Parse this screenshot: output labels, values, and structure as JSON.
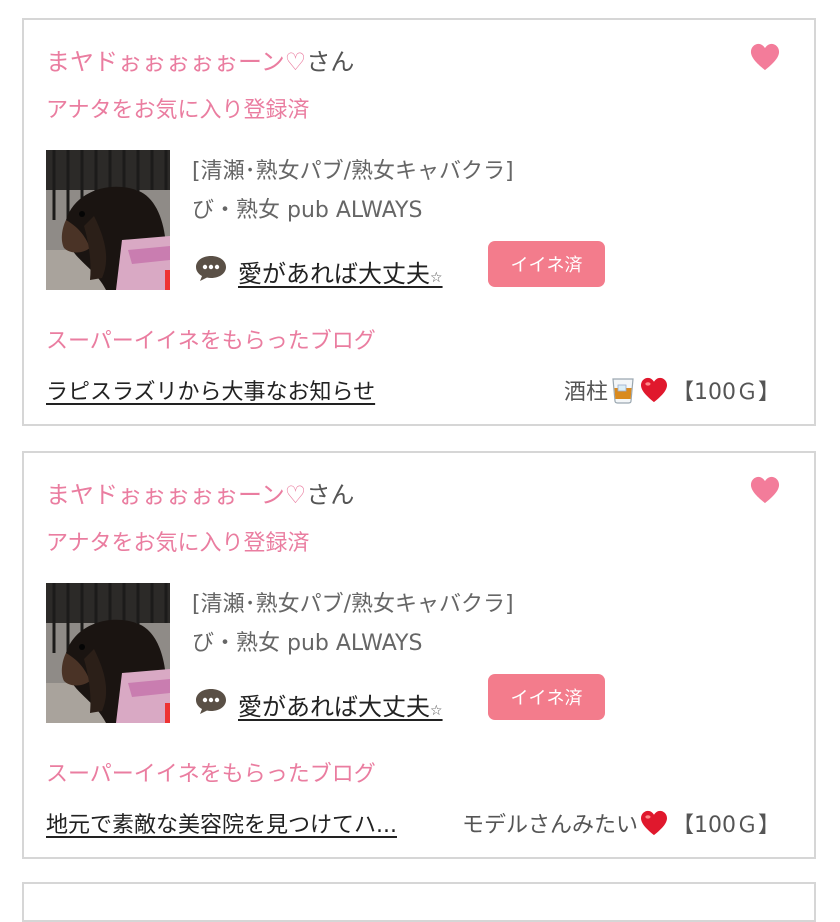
{
  "colors": {
    "accent_pink": "#ea7da0",
    "button_pink": "#f37c8c",
    "border": "#d6d6d6"
  },
  "favorites": [
    {
      "user_name": "まヤドぉぉぉぉぉーン♡",
      "suffix": "さん",
      "status": "アナタをお気に入り登録済",
      "shop_category": "[清瀬･熟女パブ/熟女キャバクラ]",
      "shop_name": "び・熟女 pub ALWAYS",
      "comment": "愛があれば大丈夫",
      "comment_mark": "☆",
      "button": "イイネ済",
      "blog_heading": "スーパーイイネをもらったブログ",
      "blog_title": "ラピスラズリから大事なお知らせ",
      "gift_label": "酒柱",
      "gift_icons": [
        "whiskey-glass-icon",
        "red-heart-icon"
      ],
      "gift_amount": "【100Ｇ】"
    },
    {
      "user_name": "まヤドぉぉぉぉぉーン♡",
      "suffix": "さん",
      "status": "アナタをお気に入り登録済",
      "shop_category": "[清瀬･熟女パブ/熟女キャバクラ]",
      "shop_name": "び・熟女 pub ALWAYS",
      "comment": "愛があれば大丈夫",
      "comment_mark": "☆",
      "button": "イイネ済",
      "blog_heading": "スーパーイイネをもらったブログ",
      "blog_title": "地元で素敵な美容院を見つけてハ...",
      "gift_label": "モデルさんみたい",
      "gift_icons": [
        "red-heart-icon"
      ],
      "gift_amount": "【100Ｇ】"
    }
  ]
}
